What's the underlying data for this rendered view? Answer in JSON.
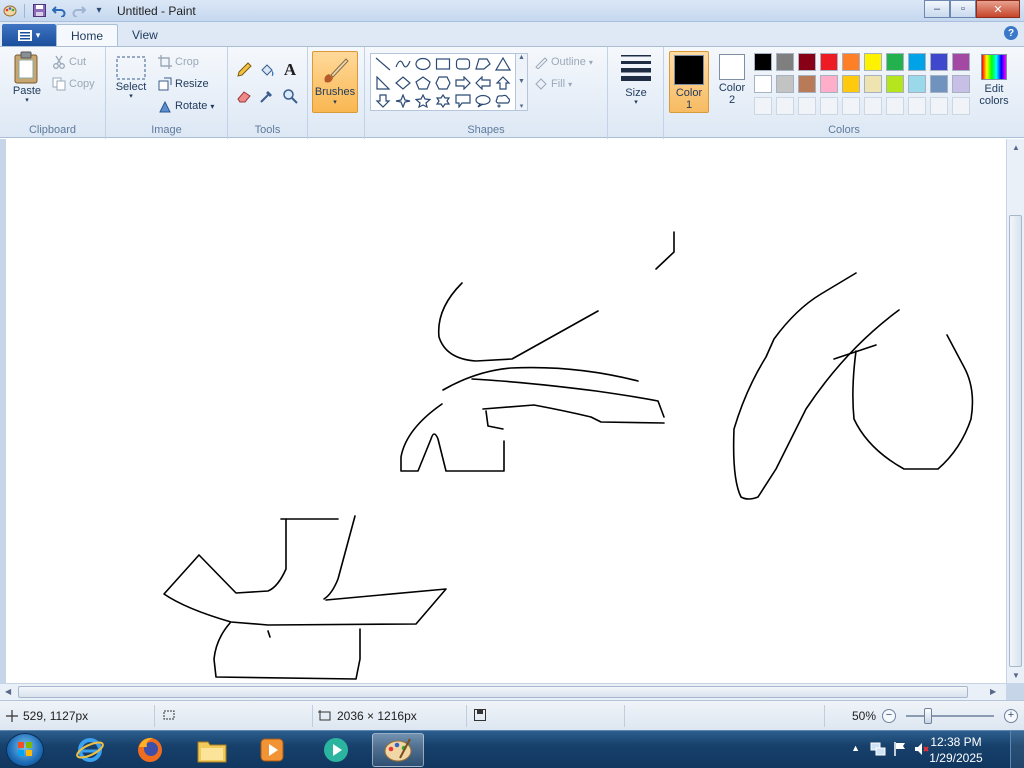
{
  "window": {
    "title": "Untitled - Paint",
    "controls": {
      "minimize": "‒",
      "maximize": "▫",
      "close": "✕"
    }
  },
  "tabs": {
    "home": "Home",
    "view": "View"
  },
  "ribbon": {
    "clipboard": {
      "label": "Clipboard",
      "paste": "Paste",
      "cut": "Cut",
      "copy": "Copy"
    },
    "image": {
      "label": "Image",
      "select": "Select",
      "crop": "Crop",
      "resize": "Resize",
      "rotate": "Rotate"
    },
    "tools": {
      "label": "Tools"
    },
    "brushes": {
      "label": "Brushes"
    },
    "shapes": {
      "label": "Shapes",
      "outline": "Outline",
      "fill": "Fill"
    },
    "size": {
      "label": "Size"
    },
    "colors": {
      "label": "Colors",
      "color1_line1": "Color",
      "color1_line2": "1",
      "color2_line1": "Color",
      "color2_line2": "2",
      "edit_line1": "Edit",
      "edit_line2": "colors",
      "color1_value": "#000000",
      "color2_value": "#ffffff",
      "palette_row1": [
        "#000000",
        "#7f7f7f",
        "#880015",
        "#ed1c24",
        "#ff7f27",
        "#fff200",
        "#22b14c",
        "#00a2e8",
        "#3f48cc",
        "#a349a4"
      ],
      "palette_row2": [
        "#ffffff",
        "#c3c3c3",
        "#b97a57",
        "#ffaec9",
        "#ffc90e",
        "#efe4b0",
        "#b5e61d",
        "#99d9ea",
        "#7092be",
        "#c8bfe7"
      ]
    }
  },
  "status": {
    "cursor_pos": "529, 1127px",
    "canvas_size": "2036 × 1216px",
    "zoom": "50%"
  },
  "taskbar": {
    "time": "12:38 PM",
    "date": "1/29/2025"
  },
  "icons": {
    "help": "?",
    "arrow_down": "▾",
    "zoom_out": "−",
    "zoom_in": "+"
  }
}
